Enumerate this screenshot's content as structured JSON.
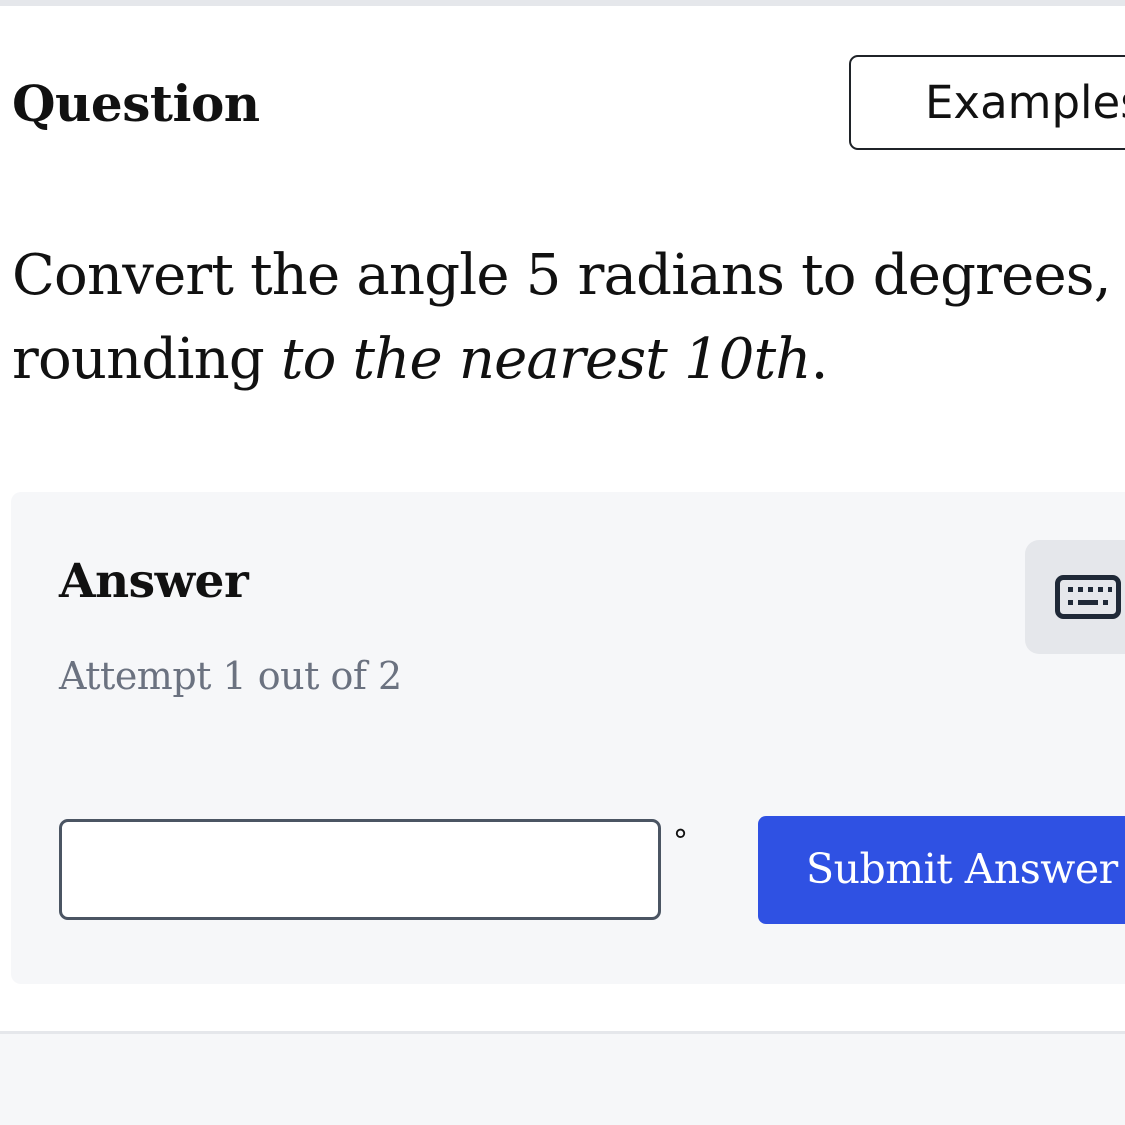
{
  "question": {
    "heading": "Question",
    "examples_label": "Examples",
    "prompt_prefix": "Convert the angle ",
    "angle_value": "5",
    "prompt_middle": " radians to degrees, rounding ",
    "rounding_phrase": "to the nearest 10th",
    "prompt_suffix": "."
  },
  "answer": {
    "heading": "Answer",
    "attempt_text": "Attempt 1 out of 2",
    "input_value": "",
    "unit_symbol": "°",
    "submit_label": "Submit Answer"
  },
  "icons": {
    "keyboard": "keyboard-icon"
  },
  "colors": {
    "submit_button": "#2f51e3",
    "panel_background": "#f6f7f9",
    "attempt_text": "#6b7280",
    "keyboard_button": "#e5e7eb"
  }
}
